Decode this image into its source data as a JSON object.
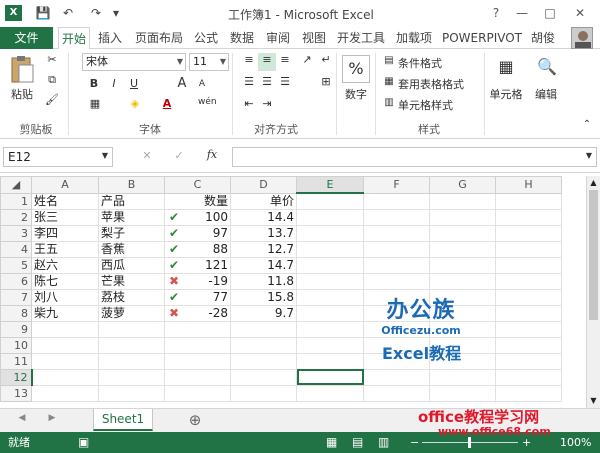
{
  "window": {
    "title": "工作簿1 - Microsoft Excel",
    "app_icon": "X",
    "help": "?",
    "minimize": "—",
    "restore": "□",
    "close": "✕"
  },
  "qat": {
    "save": "💾",
    "undo": "↶",
    "redo": "↷",
    "customize": "▾"
  },
  "tabs": [
    "文件",
    "开始",
    "插入",
    "页面布局",
    "公式",
    "数据",
    "审阅",
    "视图",
    "开发工具",
    "加载项",
    "POWERPIVOT"
  ],
  "user": "胡俊",
  "ribbon": {
    "clipboard": {
      "paste": "粘贴",
      "label": "剪贴板"
    },
    "font": {
      "name": "宋体",
      "size": "11",
      "bold": "B",
      "italic": "I",
      "underline": "U",
      "grow": "A",
      "shrink": "A",
      "label": "字体"
    },
    "alignment": {
      "label": "对齐方式"
    },
    "number": {
      "btn": "数字",
      "symbol": "%"
    },
    "styles": {
      "conditional": "条件格式",
      "table": "套用表格格式",
      "cell": "单元格样式",
      "label": "样式"
    },
    "cells": {
      "btn": "单元格"
    },
    "editing": {
      "btn": "编辑"
    }
  },
  "formula_bar": {
    "name_box": "E12",
    "cancel": "✕",
    "enter": "✓",
    "fx": "fx",
    "value": ""
  },
  "columns": [
    "A",
    "B",
    "C",
    "D",
    "E",
    "F",
    "G",
    "H"
  ],
  "rows": [
    {
      "n": "1",
      "a": "姓名",
      "b": "产品",
      "c": "数量",
      "mark": "",
      "d": "单价"
    },
    {
      "n": "2",
      "a": "张三",
      "b": "苹果",
      "c": "100",
      "mark": "check",
      "d": "14.4"
    },
    {
      "n": "3",
      "a": "李四",
      "b": "梨子",
      "c": "97",
      "mark": "check",
      "d": "13.7"
    },
    {
      "n": "4",
      "a": "王五",
      "b": "香蕉",
      "c": "88",
      "mark": "check",
      "d": "12.7"
    },
    {
      "n": "5",
      "a": "赵六",
      "b": "西瓜",
      "c": "121",
      "mark": "check",
      "d": "14.7"
    },
    {
      "n": "6",
      "a": "陈七",
      "b": "芒果",
      "c": "-19",
      "mark": "cross",
      "d": "11.8"
    },
    {
      "n": "7",
      "a": "刘八",
      "b": "荔枝",
      "c": "77",
      "mark": "check",
      "d": "15.8"
    },
    {
      "n": "8",
      "a": "柴九",
      "b": "菠萝",
      "c": "-28",
      "mark": "cross",
      "d": "9.7"
    },
    {
      "n": "9",
      "a": "",
      "b": "",
      "c": "",
      "mark": "",
      "d": ""
    },
    {
      "n": "10",
      "a": "",
      "b": "",
      "c": "",
      "mark": "",
      "d": ""
    },
    {
      "n": "11",
      "a": "",
      "b": "",
      "c": "",
      "mark": "",
      "d": ""
    },
    {
      "n": "12",
      "a": "",
      "b": "",
      "c": "",
      "mark": "",
      "d": ""
    },
    {
      "n": "13",
      "a": "",
      "b": "",
      "c": "",
      "mark": "",
      "d": ""
    }
  ],
  "sheet_tabs": {
    "active": "Sheet1",
    "add": "⊕"
  },
  "status": {
    "ready": "就绪",
    "zoom": "100%"
  },
  "watermarks": {
    "logo": "办公族",
    "logo_url": "Officezu.com",
    "excel": "Excel教程",
    "site": "office教程学习网",
    "site_url": "www.office68.com"
  },
  "colors": {
    "accent": "#217346",
    "check": "#2e8b2e",
    "cross": "#d9534f"
  }
}
